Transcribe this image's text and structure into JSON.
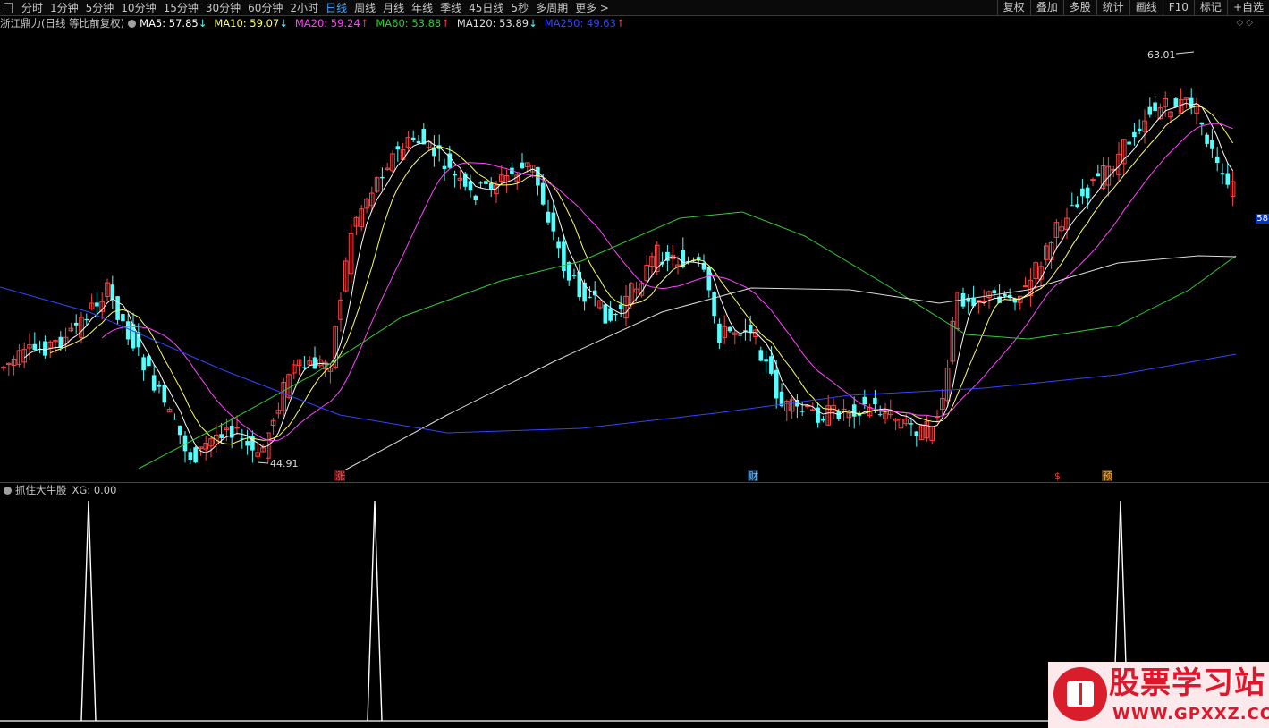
{
  "toolbar": {
    "periods": [
      "分时",
      "1分钟",
      "5分钟",
      "10分钟",
      "15分钟",
      "30分钟",
      "60分钟",
      "2小时",
      "日线",
      "周线",
      "月线",
      "年线",
      "季线",
      "45日线",
      "5秒",
      "多周期",
      "更多 >"
    ],
    "active_period": "日线",
    "right_tools": [
      "复权",
      "叠加",
      "多股",
      "统计",
      "画线",
      "F10",
      "标记",
      "+自选"
    ]
  },
  "legend": {
    "title": "浙江鼎力(日线 等比前复权)",
    "items": [
      {
        "label": "MA5: 57.85",
        "arrow": "↓",
        "color": "#ffffff"
      },
      {
        "label": "MA10: 59.07",
        "arrow": "↓",
        "color": "#ffff66"
      },
      {
        "label": "MA20: 59.24",
        "arrow": "↑",
        "color": "#ff44ff"
      },
      {
        "label": "MA60: 53.88",
        "arrow": "↑",
        "color": "#33cc33"
      },
      {
        "label": "MA120: 53.89",
        "arrow": "↓",
        "color": "#dddddd"
      },
      {
        "label": "MA250: 49.63",
        "arrow": "↑",
        "color": "#3344ff"
      }
    ]
  },
  "price_high_label": "63.01",
  "price_low_label": "44.91",
  "markers": [
    {
      "text": "涨",
      "color": "#ff5555",
      "bg": "#5a1010"
    },
    {
      "text": "财",
      "color": "#66ccff",
      "bg": "#10305a"
    },
    {
      "text": "$",
      "color": "#ff3333",
      "bg": "#000000"
    },
    {
      "text": "预",
      "color": "#ffaa33",
      "bg": "#5a3a10"
    }
  ],
  "right_edge_tag": "58",
  "sub_legend": {
    "title": "抓住大牛股",
    "value": "XG: 0.00"
  },
  "watermark": {
    "title": "股票学习站",
    "url": "WWW.GPXXZ.COM"
  },
  "colors": {
    "up": "#ff4444",
    "down": "#54ffff",
    "ma5": "#ffffff",
    "ma10": "#ffff66",
    "ma20": "#ff44ff",
    "ma60": "#33cc33",
    "ma120": "#dddddd",
    "ma250": "#3344ff"
  }
}
